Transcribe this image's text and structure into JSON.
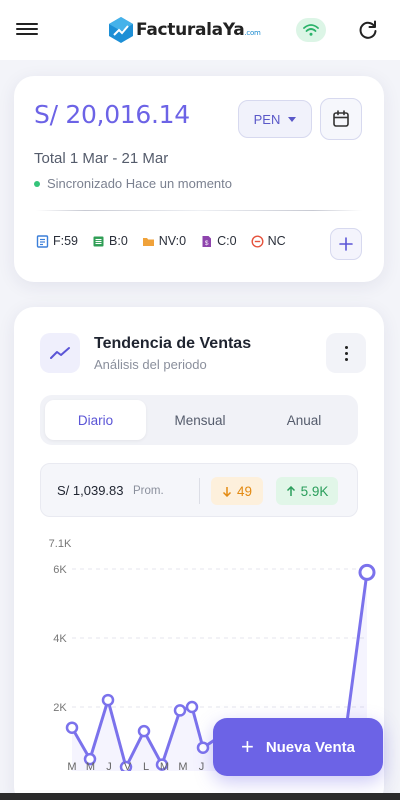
{
  "header": {
    "logo_text": "FacturalaYa",
    "logo_suffix": ".com",
    "menu_icon": "hamburger-menu-icon",
    "wifi_icon": "wifi-icon",
    "refresh_icon": "refresh-icon",
    "wifi_color": "#2bb36a"
  },
  "summary": {
    "amount": "S/ 20,016.14",
    "currency": "PEN",
    "period": "Total 1 Mar - 21 Mar",
    "sync_status": "Sincronizado Hace un momento",
    "accent": "#6c63e6",
    "docs": [
      {
        "icon": "invoice-icon",
        "label": "F:59",
        "color": "#3b7fd9"
      },
      {
        "icon": "receipt-icon",
        "label": "B:0",
        "color": "#2f9e55"
      },
      {
        "icon": "folder-icon",
        "label": "NV:0",
        "color": "#f0a23a"
      },
      {
        "icon": "credit-note-icon",
        "label": "C:0",
        "color": "#8e44ad"
      },
      {
        "icon": "minus-circle-icon",
        "label": "NC",
        "color": "#e5533d"
      }
    ]
  },
  "trend": {
    "title": "Tendencia de Ventas",
    "subtitle": "Análisis del periodo",
    "tabs": [
      "Diario",
      "Mensual",
      "Anual"
    ],
    "active_tab": "Diario",
    "average_value": "S/ 1,039.83",
    "average_label": "Prom.",
    "min_value": "49",
    "max_value": "5.9K"
  },
  "chart_data": {
    "type": "line",
    "y_max_label": "7.1K",
    "y_ticks": [
      "6K",
      "4K",
      "2K"
    ],
    "ylim": [
      0,
      7100
    ],
    "x_labels": [
      "M",
      "M",
      "J",
      "V",
      "L",
      "M",
      "M",
      "J"
    ],
    "series": [
      {
        "color": "#7b72ec",
        "values": [
          1400,
          490,
          2200,
          260,
          1300,
          330,
          1900,
          2000,
          820,
          1150,
          880,
          49,
          900,
          700,
          5900
        ]
      }
    ]
  },
  "fab": {
    "label": "Nueva Venta"
  }
}
